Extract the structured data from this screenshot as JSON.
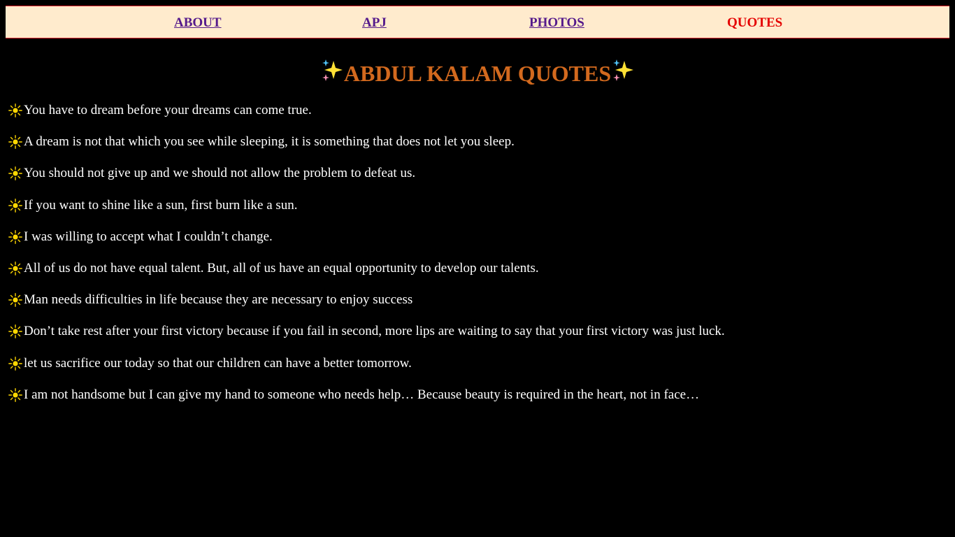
{
  "nav": {
    "links": [
      {
        "label": "ABOUT"
      },
      {
        "label": "APJ"
      },
      {
        "label": "PHOTOS"
      },
      {
        "label": "QUOTES",
        "active": true
      }
    ]
  },
  "page": {
    "title": "ABDUL KALAM QUOTES",
    "title_icon": "sparkles-icon",
    "colors": {
      "background": "#000000",
      "nav_background": "#ffebcd",
      "nav_border": "#e0202a",
      "link": "#551a8b",
      "active_link": "#e50000",
      "title": "#d2691e",
      "quote_text": "#ffffff",
      "bullet": "#ffd700"
    }
  },
  "quotes": {
    "bullet_icon": "sun-icon",
    "items": [
      "You have to dream before your dreams can come true.",
      "A dream is not that which you see while sleeping, it is something that does not let you sleep.",
      "You should not give up and we should not allow the problem to defeat us.",
      "If you want to shine like a sun, first burn like a sun.",
      "I was willing to accept what I couldn’t change.",
      "All of us do not have equal talent. But, all of us have an equal opportunity to develop our talents.",
      "Man needs difficulties in life because they are necessary to enjoy success",
      "Don’t take rest after your first victory because if you fail in second, more lips are waiting to say that your first victory was just luck.",
      "let us sacrifice our today so that our children can have a better tomorrow.",
      "I am not handsome but I can give my hand to someone who needs help… Because beauty is required in the heart, not in face…"
    ]
  }
}
